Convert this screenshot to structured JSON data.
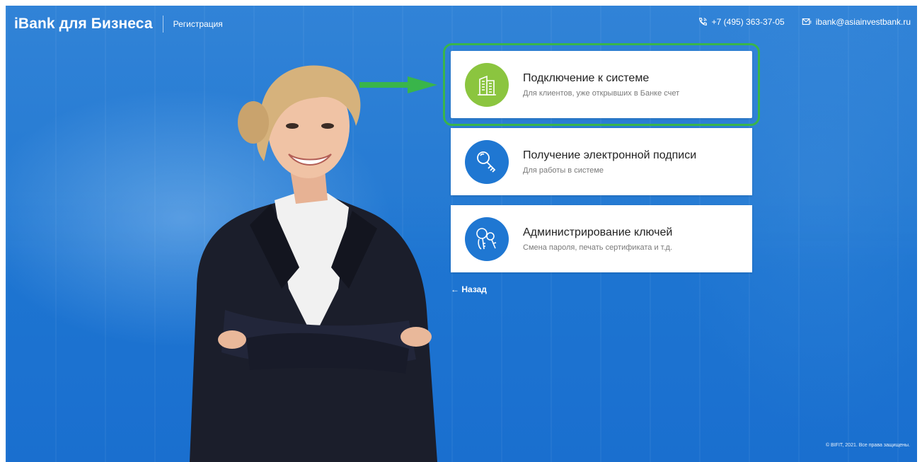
{
  "header": {
    "brand": "iBank для Бизнеса",
    "registration_link": "Регистрация",
    "phone": "+7 (495) 363-37-05",
    "email": "ibank@asiainvestbank.ru",
    "phone_icon": "phone-icon",
    "email_icon": "envelope-icon"
  },
  "cards": [
    {
      "title": "Подключение к системе",
      "subtitle": "Для клиентов, уже открывших в Банке счет",
      "icon": "building-icon",
      "icon_color": "#8bc53f"
    },
    {
      "title": "Получение электронной подписи",
      "subtitle": "Для работы в системе",
      "icon": "key-icon",
      "icon_color": "#1f77d2"
    },
    {
      "title": "Администрирование ключей",
      "subtitle": "Смена пароля, печать сертификата и т.д.",
      "icon": "keys-icon",
      "icon_color": "#1f77d2"
    }
  ],
  "back_link": "← Назад",
  "footer": "© BIFIT, 2021. Все права защищены.",
  "colors": {
    "background": "#1f77d2",
    "highlight": "#39b54a",
    "arrow": "#39b54a"
  }
}
